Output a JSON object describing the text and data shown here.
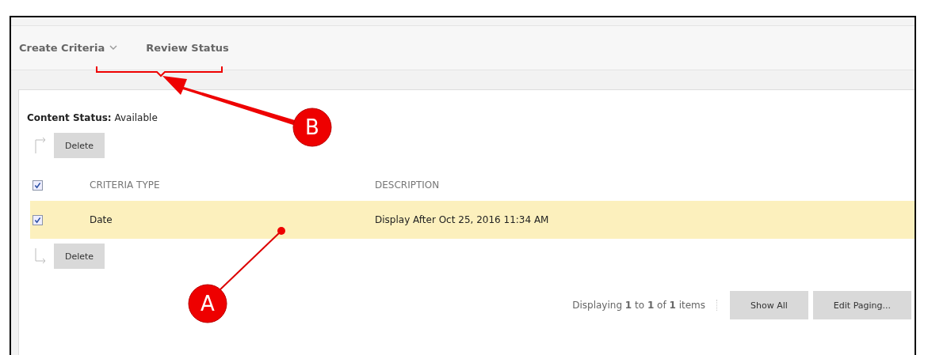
{
  "action_bar": {
    "items": [
      {
        "label": "Create Criteria",
        "kind": "menu"
      },
      {
        "label": "Review Status",
        "kind": "link"
      }
    ]
  },
  "content_status": {
    "label": "Content Status:",
    "value": "Available"
  },
  "top_actions": {
    "buttons": [
      "Delete"
    ]
  },
  "table": {
    "select_all_checked": true,
    "columns": [
      "CRITERIA TYPE",
      "DESCRIPTION"
    ],
    "rows": [
      {
        "criteria_type": "Date",
        "description": "Display After Oct 25, 2016 11:34 AM",
        "checked": true,
        "selected": true
      }
    ]
  },
  "bottom_actions": {
    "buttons": [
      "Delete"
    ]
  },
  "paging": {
    "summary": "Displaying **1** to **1** of **1** items",
    "buttons": [
      "Show All",
      "Edit Paging..."
    ]
  },
  "annotations": [
    {
      "label": "A"
    },
    {
      "label": "B"
    }
  ]
}
